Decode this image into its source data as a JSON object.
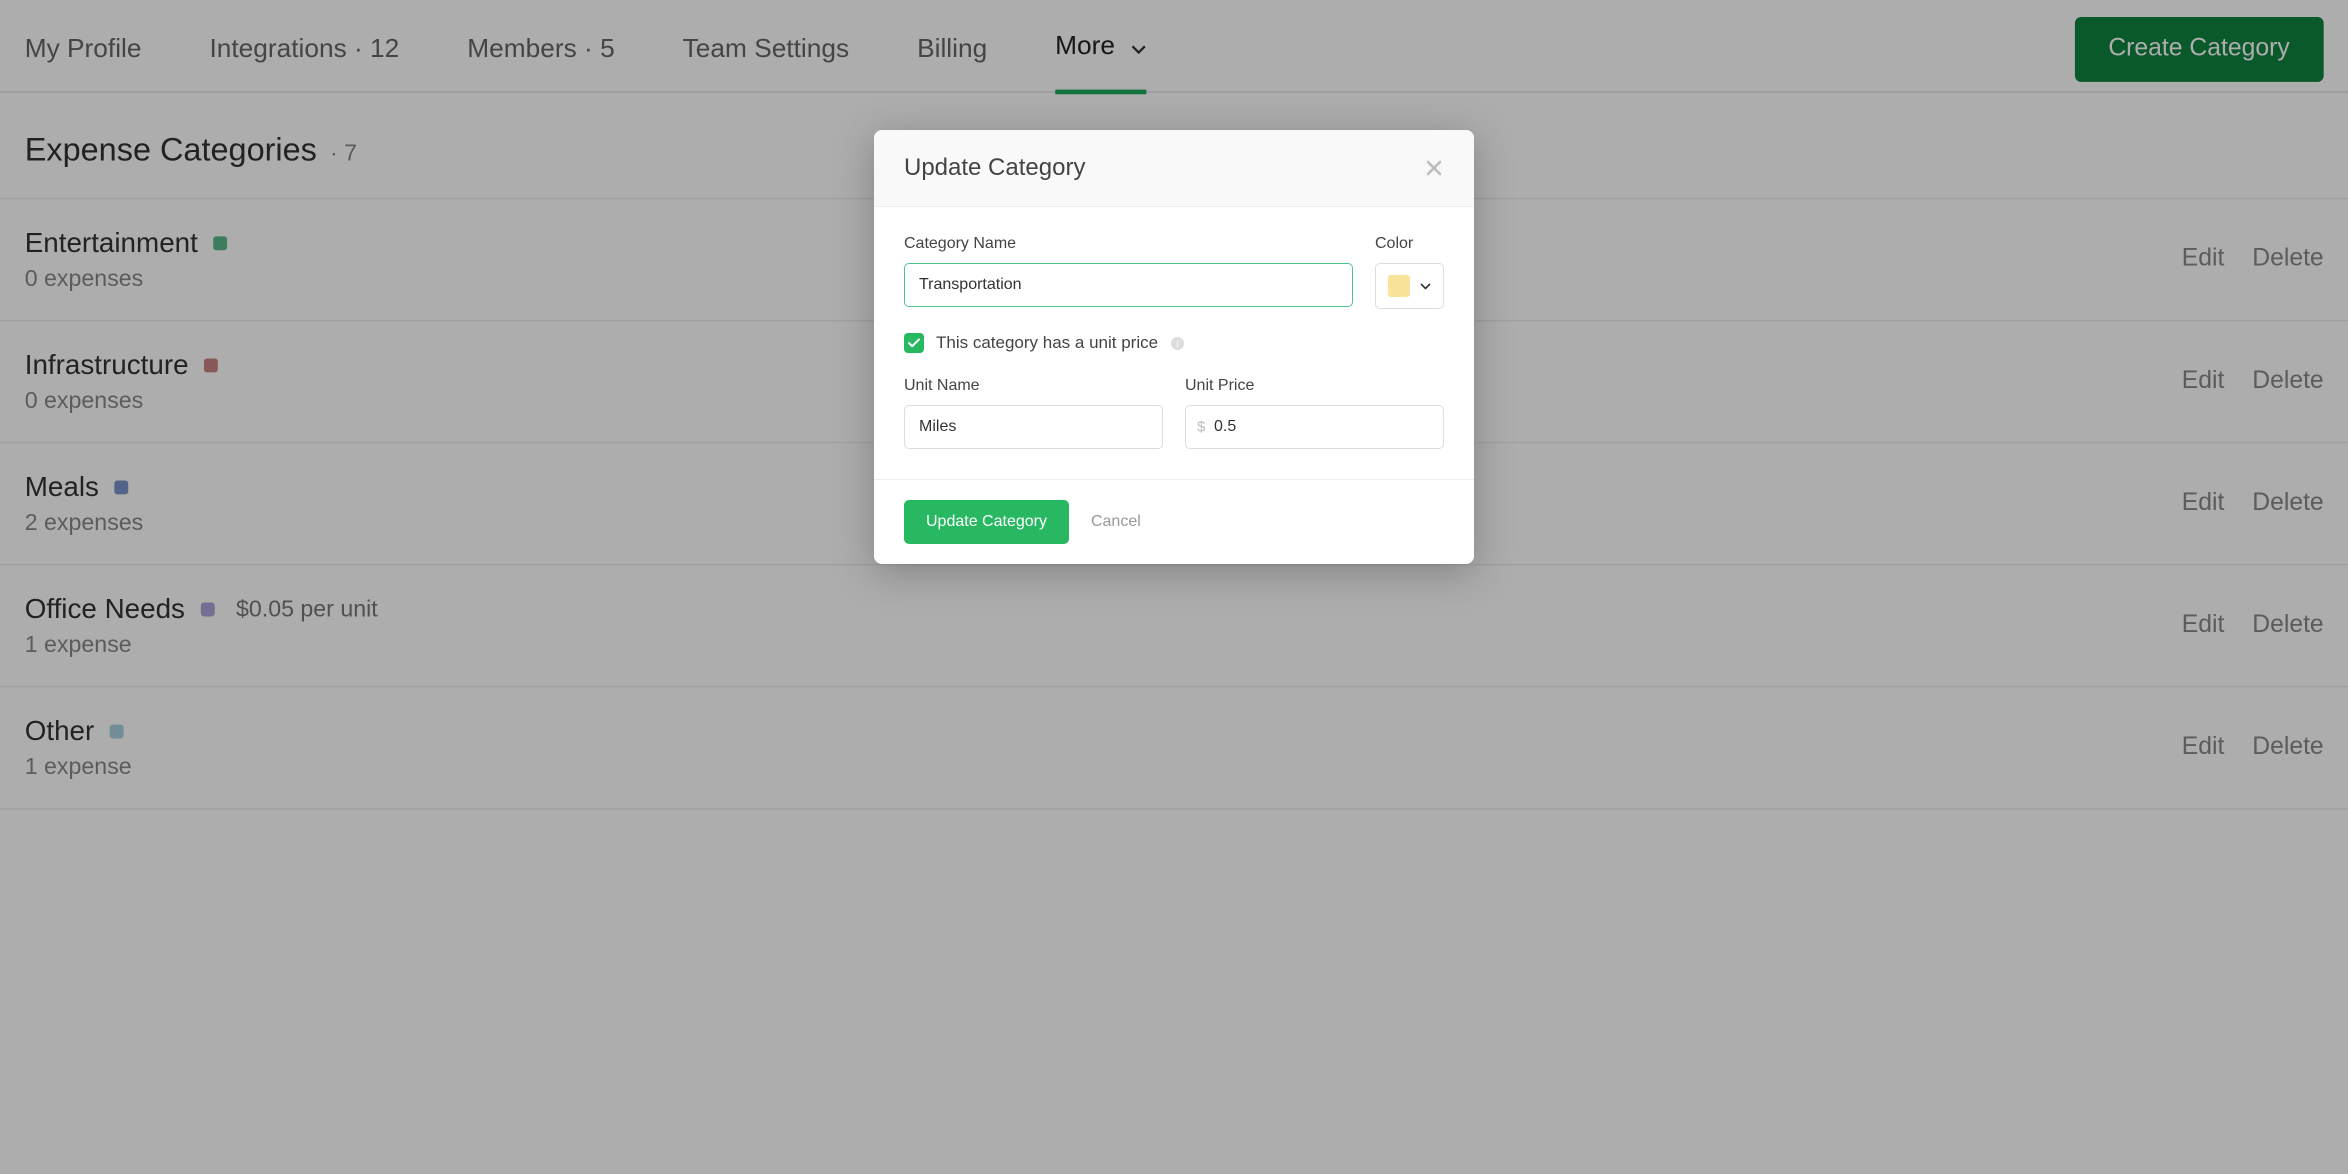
{
  "nav": {
    "tabs": [
      {
        "label": "My Profile"
      },
      {
        "label": "Integrations · 12"
      },
      {
        "label": "Members · 5"
      },
      {
        "label": "Team Settings"
      },
      {
        "label": "Billing"
      },
      {
        "label": "More"
      }
    ],
    "create_btn": "Create Category"
  },
  "section": {
    "title": "Expense Categories",
    "count": "· 7"
  },
  "actions": {
    "edit": "Edit",
    "delete": "Delete"
  },
  "categories": [
    {
      "name": "Entertainment",
      "color": "#5bb88a",
      "sub": "0 expenses",
      "per_unit": ""
    },
    {
      "name": "Infrastructure",
      "color": "#c98080",
      "sub": "0 expenses",
      "per_unit": ""
    },
    {
      "name": "Meals",
      "color": "#7a92c9",
      "sub": "2 expenses",
      "per_unit": ""
    },
    {
      "name": "Office Needs",
      "color": "#a9a4d6",
      "sub": "1 expense",
      "per_unit": "$0.05 per unit"
    },
    {
      "name": "Other",
      "color": "#a7d2e0",
      "sub": "1 expense",
      "per_unit": ""
    }
  ],
  "modal": {
    "title": "Update Category",
    "labels": {
      "category_name": "Category Name",
      "color": "Color",
      "unit_name": "Unit Name",
      "unit_price": "Unit Price"
    },
    "values": {
      "category_name": "Transportation",
      "unit_name": "Miles",
      "unit_price": "0.5",
      "color_swatch": "#f9e29a"
    },
    "checkbox_label": "This category has a unit price",
    "currency_symbol": "$",
    "buttons": {
      "submit": "Update Category",
      "cancel": "Cancel"
    }
  }
}
